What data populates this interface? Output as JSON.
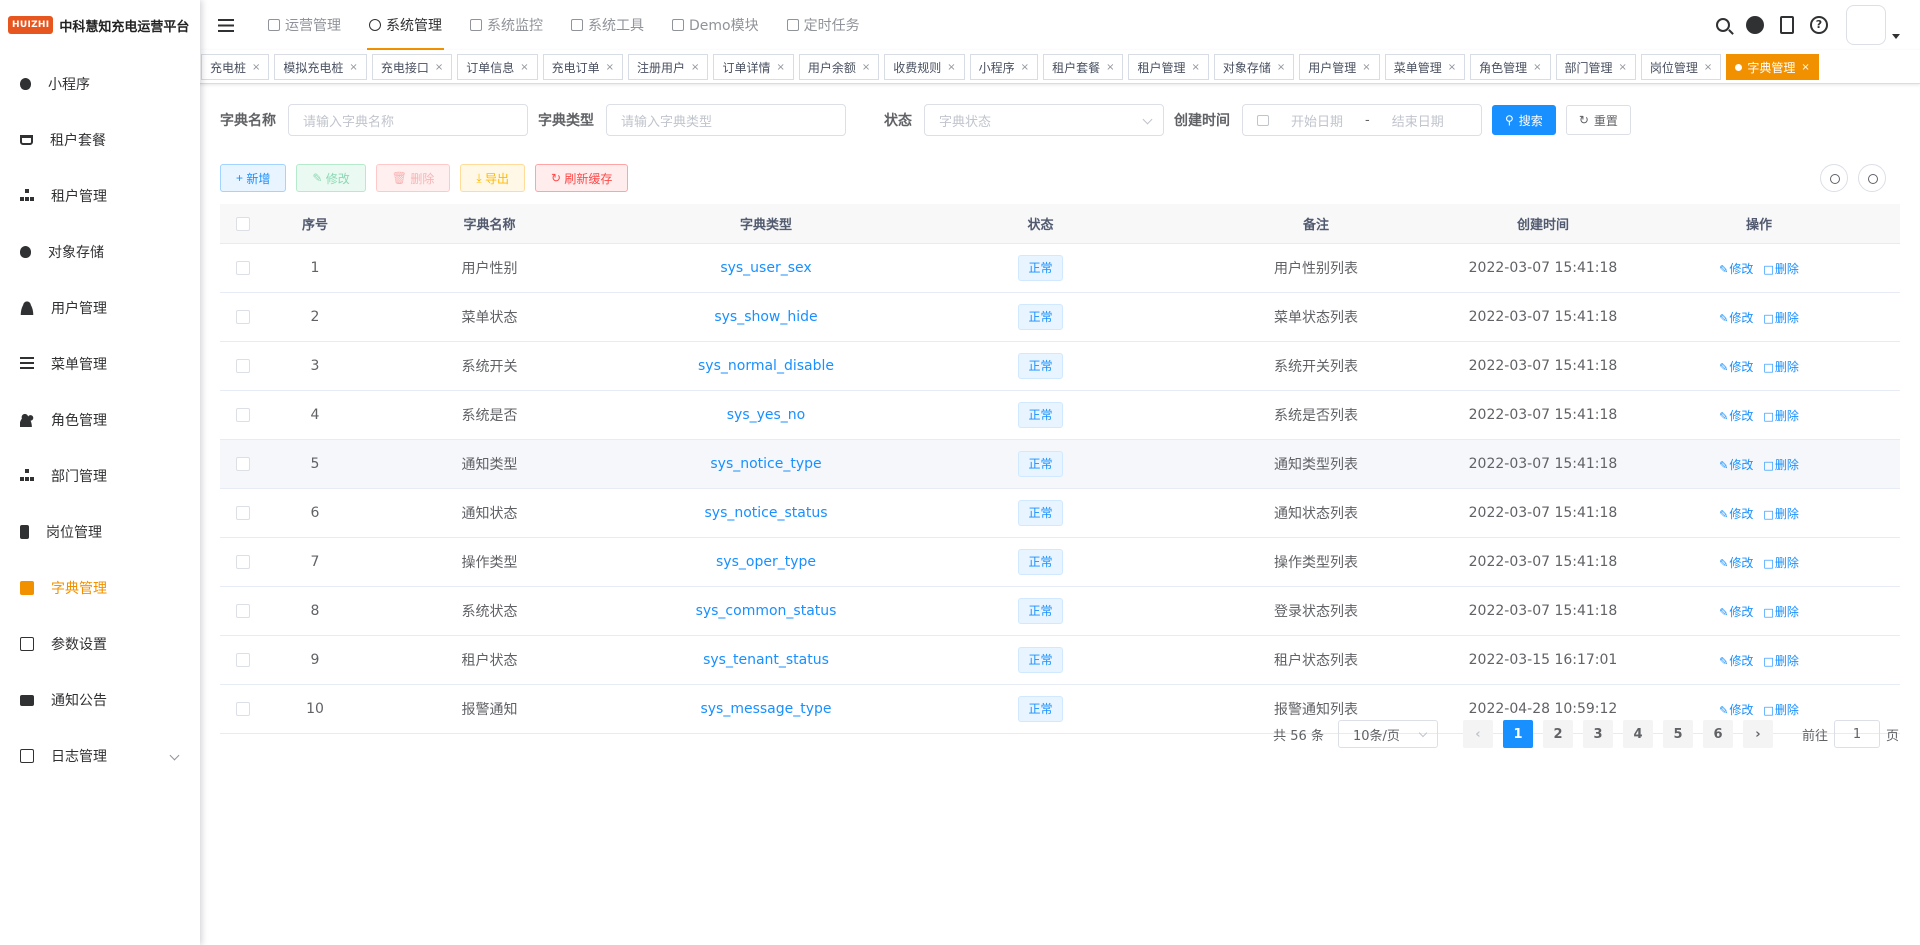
{
  "app": {
    "logo_badge": "HUIZHI",
    "title": "中科慧知充电运营平台"
  },
  "sidebar": {
    "items": [
      {
        "label": "小程序",
        "icon": "bug-icon"
      },
      {
        "label": "租户套餐",
        "icon": "cart-icon"
      },
      {
        "label": "租户管理",
        "icon": "tree-icon"
      },
      {
        "label": "对象存储",
        "icon": "bug-icon"
      },
      {
        "label": "用户管理",
        "icon": "user-icon"
      },
      {
        "label": "菜单管理",
        "icon": "list-icon"
      },
      {
        "label": "角色管理",
        "icon": "users-icon"
      },
      {
        "label": "部门管理",
        "icon": "tree-icon"
      },
      {
        "label": "岗位管理",
        "icon": "post-icon"
      },
      {
        "label": "字典管理",
        "icon": "dict-icon",
        "active": true
      },
      {
        "label": "参数设置",
        "icon": "edit-icon"
      },
      {
        "label": "通知公告",
        "icon": "message-icon"
      },
      {
        "label": "日志管理",
        "icon": "log-icon",
        "has_children": true
      }
    ],
    "active_color": "#f29100"
  },
  "topnav": {
    "items": [
      {
        "label": "运营管理"
      },
      {
        "label": "系统管理",
        "active": true
      },
      {
        "label": "系统监控"
      },
      {
        "label": "系统工具"
      },
      {
        "label": "Demo模块"
      },
      {
        "label": "定时任务"
      }
    ]
  },
  "tags": [
    "充电桩",
    "模拟充电桩",
    "充电接口",
    "订单信息",
    "充电订单",
    "注册用户",
    "订单详情",
    "用户余额",
    "收费规则",
    "小程序",
    "租户套餐",
    "租户管理",
    "对象存储",
    "用户管理",
    "菜单管理",
    "角色管理",
    "部门管理",
    "岗位管理",
    "字典管理"
  ],
  "search": {
    "dict_name_label": "字典名称",
    "dict_name_placeholder": "请输入字典名称",
    "dict_type_label": "字典类型",
    "dict_type_placeholder": "请输入字典类型",
    "status_label": "状态",
    "status_placeholder": "字典状态",
    "created_label": "创建时间",
    "start_placeholder": "开始日期",
    "range_sep": "-",
    "end_placeholder": "结束日期",
    "search_button": "搜索",
    "reset_button": "重置"
  },
  "toolbar": {
    "add": "新增",
    "edit": "修改",
    "delete": "删除",
    "export": "导出",
    "refresh_cache": "刷新缓存"
  },
  "table": {
    "headers": {
      "index": "序号",
      "name": "字典名称",
      "type": "字典类型",
      "status": "状态",
      "remark": "备注",
      "created": "创建时间",
      "ops": "操作"
    },
    "rows": [
      {
        "index": "1",
        "name": "用户性别",
        "type": "sys_user_sex",
        "status": "正常",
        "remark": "用户性别列表",
        "created": "2022-03-07 15:41:18"
      },
      {
        "index": "2",
        "name": "菜单状态",
        "type": "sys_show_hide",
        "status": "正常",
        "remark": "菜单状态列表",
        "created": "2022-03-07 15:41:18"
      },
      {
        "index": "3",
        "name": "系统开关",
        "type": "sys_normal_disable",
        "status": "正常",
        "remark": "系统开关列表",
        "created": "2022-03-07 15:41:18"
      },
      {
        "index": "4",
        "name": "系统是否",
        "type": "sys_yes_no",
        "status": "正常",
        "remark": "系统是否列表",
        "created": "2022-03-07 15:41:18"
      },
      {
        "index": "5",
        "name": "通知类型",
        "type": "sys_notice_type",
        "status": "正常",
        "remark": "通知类型列表",
        "created": "2022-03-07 15:41:18"
      },
      {
        "index": "6",
        "name": "通知状态",
        "type": "sys_notice_status",
        "status": "正常",
        "remark": "通知状态列表",
        "created": "2022-03-07 15:41:18"
      },
      {
        "index": "7",
        "name": "操作类型",
        "type": "sys_oper_type",
        "status": "正常",
        "remark": "操作类型列表",
        "created": "2022-03-07 15:41:18"
      },
      {
        "index": "8",
        "name": "系统状态",
        "type": "sys_common_status",
        "status": "正常",
        "remark": "登录状态列表",
        "created": "2022-03-07 15:41:18"
      },
      {
        "index": "9",
        "name": "租户状态",
        "type": "sys_tenant_status",
        "status": "正常",
        "remark": "租户状态列表",
        "created": "2022-03-15 16:17:01"
      },
      {
        "index": "10",
        "name": "报警通知",
        "type": "sys_message_type",
        "status": "正常",
        "remark": "报警通知列表",
        "created": "2022-04-28 10:59:12"
      }
    ],
    "row_ops": {
      "edit": "修改",
      "delete": "删除"
    }
  },
  "pagination": {
    "total_text": "共 56 条",
    "page_size": "10条/页",
    "pages": [
      "1",
      "2",
      "3",
      "4",
      "5",
      "6"
    ],
    "current": "1",
    "goto_prefix": "前往",
    "goto_value": "1",
    "goto_suffix": "页"
  }
}
